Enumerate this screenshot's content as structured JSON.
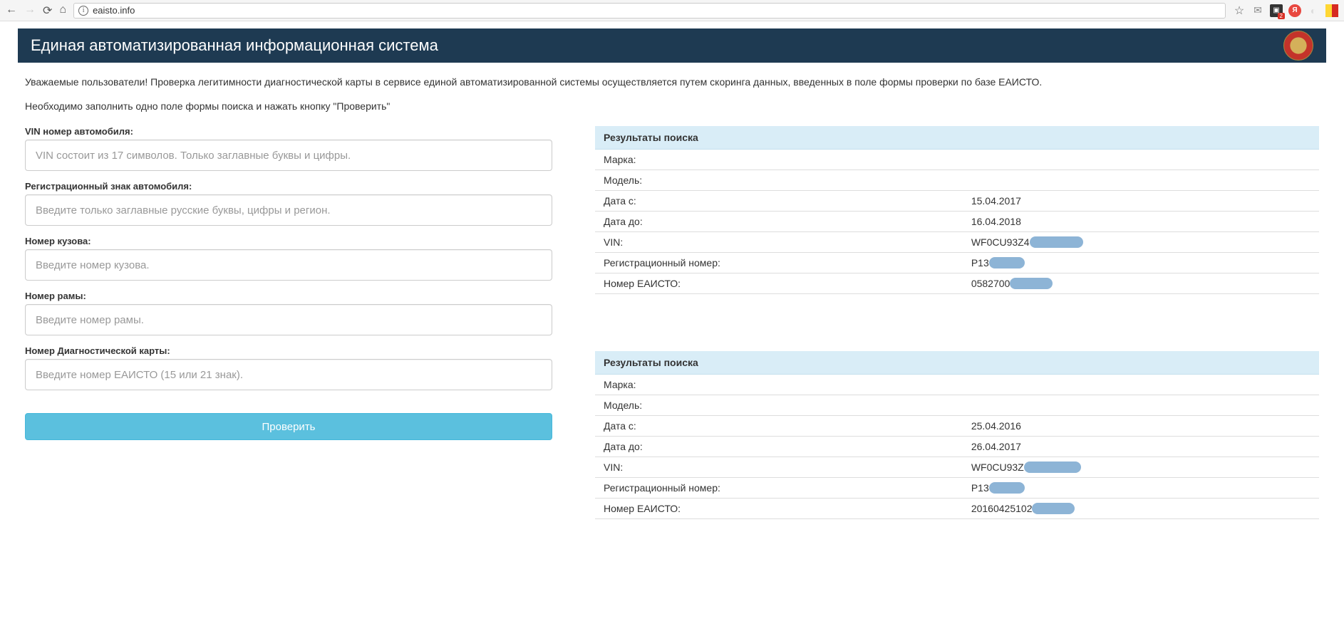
{
  "browser": {
    "url": "eaisto.info"
  },
  "header": {
    "title": "Единая автоматизированная информационная система"
  },
  "intro": {
    "p1": "Уважаемые пользователи! Проверка легитимности диагностической карты в сервисе единой автоматизированной системы осуществляется путем скоринга данных, введенных в поле формы проверки по базе ЕАИСТО.",
    "p2": "Необходимо заполнить одно поле формы поиска и нажать кнопку \"Проверить\""
  },
  "form": {
    "vin_label": "VIN номер автомобиля:",
    "vin_placeholder": "VIN состоит из 17 символов. Только заглавные буквы и цифры.",
    "reg_label": "Регистрационный знак автомобиля:",
    "reg_placeholder": "Введите только заглавные русские буквы, цифры и регион.",
    "body_label": "Номер кузова:",
    "body_placeholder": "Введите номер кузова.",
    "frame_label": "Номер рамы:",
    "frame_placeholder": "Введите номер рамы.",
    "diag_label": "Номер Диагностической карты:",
    "diag_placeholder": "Введите номер ЕАИСТО (15 или 21 знак).",
    "submit": "Проверить"
  },
  "results": {
    "header": "Результаты поиска",
    "labels": {
      "brand": "Марка:",
      "model": "Модель:",
      "date_from": "Дата с:",
      "date_to": "Дата до:",
      "vin": "VIN:",
      "regnum": "Регистрационный номер:",
      "eaisto": "Номер ЕАИСТО:"
    },
    "panel1": {
      "brand": "",
      "model": "",
      "date_from": "15.04.2017",
      "date_to": "16.04.2018",
      "vin": "WF0CU93Z4",
      "regnum": "Р13",
      "eaisto": "0582700"
    },
    "panel2": {
      "brand": "",
      "model": "",
      "date_from": "25.04.2016",
      "date_to": "26.04.2017",
      "vin": "WF0CU93Z",
      "regnum": "Р13",
      "eaisto": "20160425102"
    }
  }
}
